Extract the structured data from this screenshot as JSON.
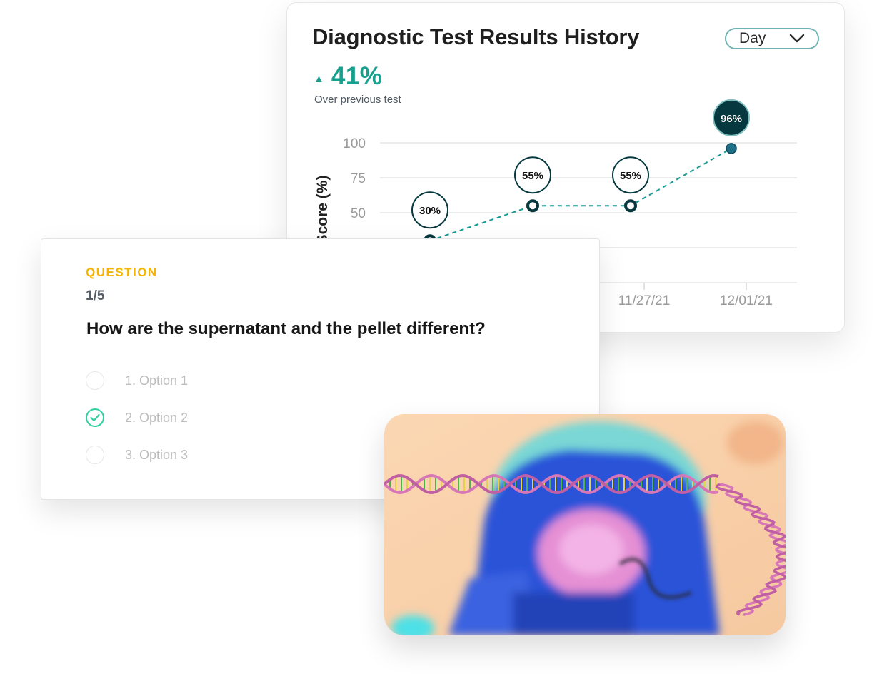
{
  "history_card": {
    "title": "Diagnostic Test Results History",
    "period": "Day",
    "delta_arrow": "▲",
    "delta_value": "41%",
    "delta_caption": "Over previous test",
    "accent_color": "#18a08f",
    "line_color": "#169a92",
    "dark_node_color": "#06393f"
  },
  "chart_data": {
    "type": "line",
    "ylabel": "Score (%)",
    "y_ticks": [
      "100",
      "75",
      "50"
    ],
    "ylim": [
      0,
      100
    ],
    "x_tick_labels": [
      "11/27/21",
      "12/01/21"
    ],
    "series": [
      {
        "values": [
          30,
          55,
          55,
          96
        ],
        "labels": [
          "30%",
          "55%",
          "55%",
          "96%"
        ]
      }
    ],
    "grid": true
  },
  "question_card": {
    "label": "QUESTION",
    "progress": "1/5",
    "text": "How are the supernatant and the pellet different?",
    "options": [
      {
        "label": "1. Option 1",
        "selected": false
      },
      {
        "label": "2. Option 2",
        "selected": true
      },
      {
        "label": "3. Option 3",
        "selected": false
      }
    ],
    "check_color": "#2ed0a0"
  },
  "illustration": {
    "icon": "dna-cell-illustration"
  }
}
